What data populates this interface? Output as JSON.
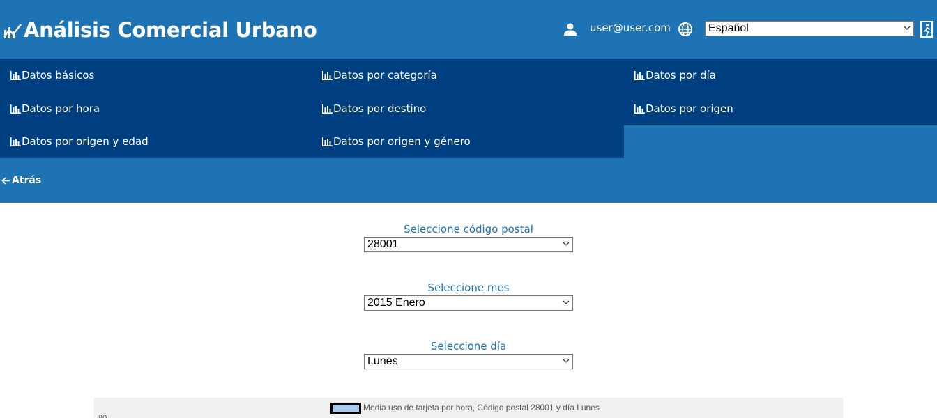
{
  "header": {
    "title": "Análisis Comercial Urbano",
    "brand_icon": "chart-trend-icon",
    "user_icon": "person-icon",
    "user_email": "user@user.com",
    "globe_icon": "globe-icon",
    "language_selected": "Español",
    "logout_icon": "logout-icon"
  },
  "nav": {
    "items": [
      {
        "label": "Datos básicos"
      },
      {
        "label": "Datos por categoría"
      },
      {
        "label": "Datos por día"
      },
      {
        "label": "Datos por hora"
      },
      {
        "label": "Datos por destino"
      },
      {
        "label": "Datos por origen"
      },
      {
        "label": "Datos por origen y edad"
      },
      {
        "label": "Datos por origen y género"
      }
    ],
    "item_icon": "bar-chart-icon"
  },
  "back": {
    "label": "Atrás",
    "icon": "arrow-left-icon"
  },
  "form": {
    "postal_label": "Seleccione código postal",
    "postal_value": "28001",
    "month_label": "Seleccione mes",
    "month_value": "2015 Enero",
    "day_label": "Seleccione día",
    "day_value": "Lunes"
  },
  "chart_data": {
    "type": "bar",
    "legend": [
      "Media uso de tarjeta por hora, Código postal 28001 y día Lunes"
    ],
    "series": [
      {
        "name": "Media uso de tarjeta por hora, Código postal 28001 y día Lunes",
        "color": "#a8ccf0"
      }
    ],
    "y_tick_top": "80"
  },
  "colors": {
    "header_bg": "#1e73b5",
    "nav_item_bg": "#004080",
    "label_color": "#1e73b5",
    "chart_bg": "#f0f0f0"
  }
}
